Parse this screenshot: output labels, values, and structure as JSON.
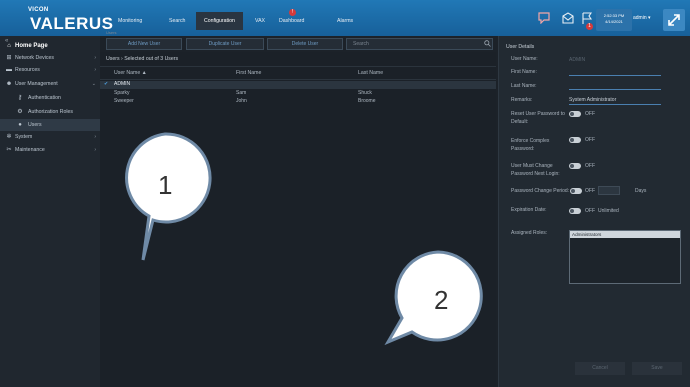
{
  "header": {
    "logo_small": "VICON",
    "logo_big": "VALERUS",
    "nav": [
      "Monitoring",
      "Search",
      "Configuration",
      "VAX",
      "Dashboard",
      "Alarms"
    ],
    "alarm_badge": "!",
    "notification_badge": "1",
    "clock_time": "2:52:33 PM",
    "clock_date": "4/14/2021",
    "user_menu": "admin",
    "colors": {
      "bar": "#1f6fa8",
      "active_tab": "#2a3541",
      "alert": "#d53a3a"
    }
  },
  "sidebar": {
    "back": "«",
    "items": [
      {
        "label": "Home Page",
        "icon": "home-icon"
      },
      {
        "label": "Network Devices",
        "icon": "network-icon"
      },
      {
        "label": "Resources",
        "icon": "resources-icon"
      },
      {
        "label": "User Management",
        "icon": "user-management-icon"
      },
      {
        "label": "Authentication",
        "icon": "key-icon"
      },
      {
        "label": "Authorization Roles",
        "icon": "roles-icon"
      },
      {
        "label": "Users",
        "icon": "user-icon"
      },
      {
        "label": "System",
        "icon": "gear-icon"
      },
      {
        "label": "Maintenance",
        "icon": "tools-icon"
      }
    ]
  },
  "toolbar": {
    "breadcrumb_top": "Users",
    "add_user": "Add New User",
    "duplicate_user": "Duplicate User",
    "delete_user": "Delete User",
    "search_placeholder": "Search"
  },
  "table": {
    "crumb_root": "Users",
    "crumb_sep": "›",
    "crumb_selection": "Selected out of 3 Users",
    "columns": [
      "User Name ▲",
      "First Name",
      "Last Name"
    ],
    "rows": [
      {
        "check": "✔",
        "user": "ADMIN",
        "first": "",
        "last": ""
      },
      {
        "check": "",
        "user": "Sparky",
        "first": "Sam",
        "last": "Shuck"
      },
      {
        "check": "",
        "user": "Sweeper",
        "first": "John",
        "last": "Broome"
      }
    ]
  },
  "details": {
    "title": "User Details",
    "user_name_label": "User Name:",
    "user_name_value": "ADMIN",
    "first_name_label": "First Name:",
    "last_name_label": "Last Name:",
    "remarks_label": "Remarks:",
    "remarks_value": "System Administrator",
    "reset_label_1": "Reset User Password to",
    "reset_label_2": "Default:",
    "reset_state": "OFF",
    "complex_label_1": "Enforce Complex",
    "complex_label_2": "Password:",
    "complex_state": "OFF",
    "must_change_label_1": "User Must Change",
    "must_change_label_2": "Password Next Login:",
    "must_change_state": "OFF",
    "pwd_period_label": "Password Change Period:",
    "pwd_period_state": "OFF",
    "pwd_period_unit": "Days",
    "expiration_label": "Expiration Date:",
    "expiration_state": "OFF",
    "expiration_value": "Unlimited",
    "roles_label": "Assigned Roles:",
    "roles_selected": "Administrators",
    "cancel_label": "Cancel",
    "save_label": "Save"
  },
  "callouts": [
    "1",
    "2"
  ]
}
